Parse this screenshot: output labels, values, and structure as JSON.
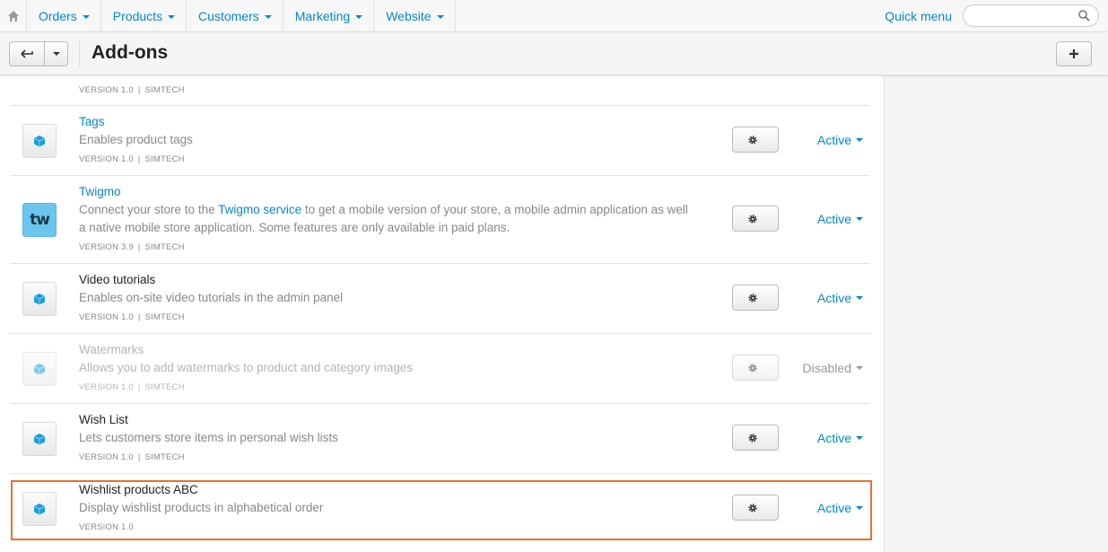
{
  "topnav": {
    "menus": [
      {
        "label": "Orders"
      },
      {
        "label": "Products"
      },
      {
        "label": "Customers"
      },
      {
        "label": "Marketing"
      },
      {
        "label": "Website"
      }
    ],
    "quick_menu": "Quick menu",
    "search": {
      "value": "",
      "placeholder": ""
    }
  },
  "header": {
    "title": "Add-ons"
  },
  "colors": {
    "link": "#0388cc",
    "highlight": "#e8712b",
    "addon_cube": "#1a9fdb"
  },
  "addons": [
    {
      "name": "",
      "description": "",
      "version": "VERSION 1.0",
      "developer": "SIMTECH",
      "status": "",
      "partial": true
    },
    {
      "name": "Tags",
      "description": "Enables product tags",
      "version": "VERSION 1.0",
      "developer": "SIMTECH",
      "status": "Active",
      "icon": "cube-icon"
    },
    {
      "name": "Twigmo",
      "description_before": "Connect your store to the ",
      "description_link": "Twigmo service",
      "description_after": " to get a mobile version of your store, a mobile admin application as well a native mobile store application. Some features are only available in paid plans.",
      "version": "VERSION 3.9",
      "developer": "SIMTECH",
      "status": "Active",
      "icon": "twigmo-logo-icon",
      "icon_text": "tw"
    },
    {
      "name": "Video tutorials",
      "description": "Enables on-site video tutorials in the admin panel",
      "version": "VERSION 1.0",
      "developer": "SIMTECH",
      "status": "Active",
      "icon": "cube-icon"
    },
    {
      "name": "Watermarks",
      "description": "Allows you to add watermarks to product and category images",
      "version": "VERSION 1.0",
      "developer": "SIMTECH",
      "status": "Disabled",
      "icon": "cube-icon"
    },
    {
      "name": "Wish List",
      "description": "Lets customers store items in personal wish lists",
      "version": "VERSION 1.0",
      "developer": "SIMTECH",
      "status": "Active",
      "icon": "cube-icon"
    },
    {
      "name": "Wishlist products ABC",
      "description": "Display wishlist products in alphabetical order",
      "version": "VERSION 1.0",
      "developer": "",
      "status": "Active",
      "icon": "cube-icon",
      "highlighted": true
    }
  ]
}
